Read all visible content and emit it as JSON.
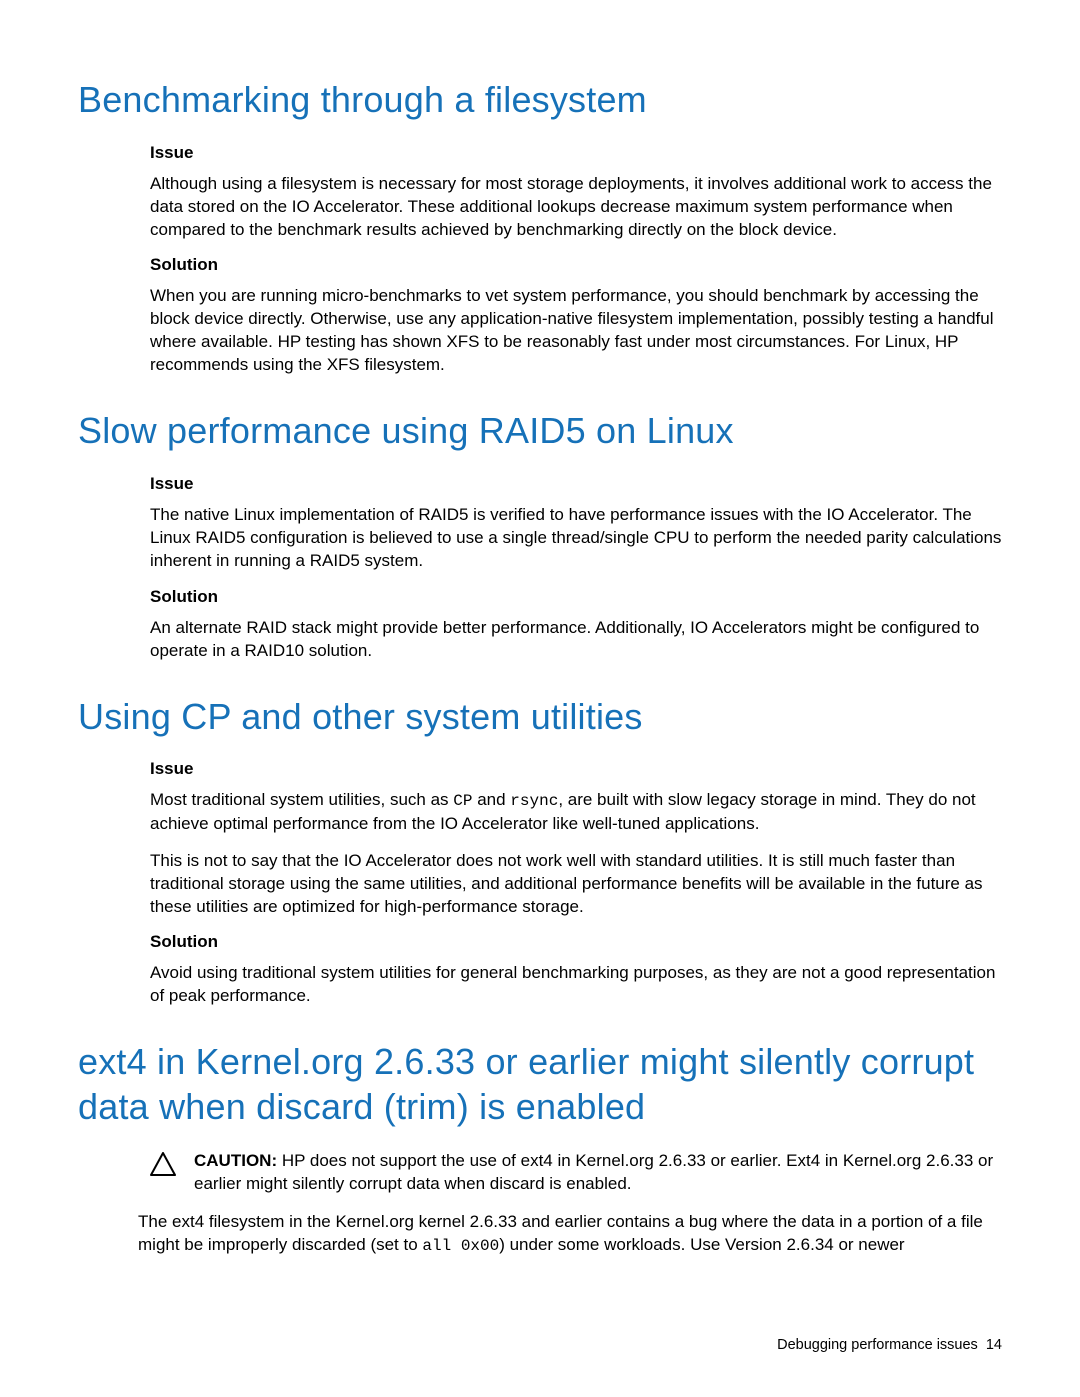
{
  "sections": [
    {
      "title": "Benchmarking through a filesystem",
      "blocks": [
        {
          "type": "heading",
          "text": "Issue"
        },
        {
          "type": "para",
          "text": "Although using a filesystem is necessary for most storage deployments, it involves additional work to access the data stored on the IO Accelerator. These additional lookups decrease maximum system performance when compared to the benchmark results achieved by benchmarking directly on the block device."
        },
        {
          "type": "heading",
          "text": "Solution"
        },
        {
          "type": "para",
          "text": "When you are running micro-benchmarks to vet system performance, you should benchmark by accessing the block device directly. Otherwise, use any application-native filesystem implementation, possibly testing a handful where available. HP testing has shown XFS to be reasonably fast under most circumstances. For Linux, HP recommends using the XFS filesystem."
        }
      ]
    },
    {
      "title": "Slow performance using RAID5 on Linux",
      "blocks": [
        {
          "type": "heading",
          "text": "Issue"
        },
        {
          "type": "para",
          "text": "The native Linux implementation of RAID5 is verified to have performance issues with the IO Accelerator. The Linux RAID5 configuration is believed to use a single thread/single CPU to perform the needed parity calculations inherent in running a RAID5 system."
        },
        {
          "type": "heading",
          "text": "Solution"
        },
        {
          "type": "para",
          "text": "An alternate RAID stack might provide better performance. Additionally, IO Accelerators might be configured to operate in a RAID10 solution."
        }
      ]
    },
    {
      "title": "Using CP and other system utilities",
      "blocks": [
        {
          "type": "heading",
          "text": "Issue"
        },
        {
          "type": "para-mixed",
          "segments": [
            {
              "t": "Most traditional system utilities, such as "
            },
            {
              "t": "CP",
              "code": true
            },
            {
              "t": " and "
            },
            {
              "t": "rsync",
              "code": true
            },
            {
              "t": ", are built with slow legacy storage in mind. They do not achieve optimal performance from the IO Accelerator like well-tuned applications."
            }
          ]
        },
        {
          "type": "para",
          "text": "This is not to say that the IO Accelerator does not work well with standard utilities. It is still much faster than traditional storage using the same utilities, and additional performance benefits will be available in the future as these utilities are optimized for high-performance storage."
        },
        {
          "type": "heading",
          "text": "Solution"
        },
        {
          "type": "para",
          "text": "Avoid using traditional system utilities for general benchmarking purposes, as they are not a good representation of peak performance."
        }
      ]
    },
    {
      "title": "ext4 in Kernel.org 2.6.33 or earlier might silently corrupt data when discard (trim) is enabled",
      "caution": {
        "label": "CAUTION:",
        "text": "HP does not support the use of ext4 in Kernel.org 2.6.33 or earlier. Ext4 in Kernel.org 2.6.33 or earlier might silently corrupt data when discard is enabled."
      },
      "blocks": [
        {
          "type": "para-mixed",
          "noindent": false,
          "segments": [
            {
              "t": "The ext4 filesystem in the Kernel.org kernel 2.6.33 and earlier contains a bug where the data in a portion of a file might be improperly discarded (set to "
            },
            {
              "t": "all 0x00",
              "code": true
            },
            {
              "t": ") under some workloads. Use Version 2.6.34 or newer"
            }
          ]
        }
      ]
    }
  ],
  "footer": {
    "text": "Debugging performance issues",
    "page": "14"
  }
}
